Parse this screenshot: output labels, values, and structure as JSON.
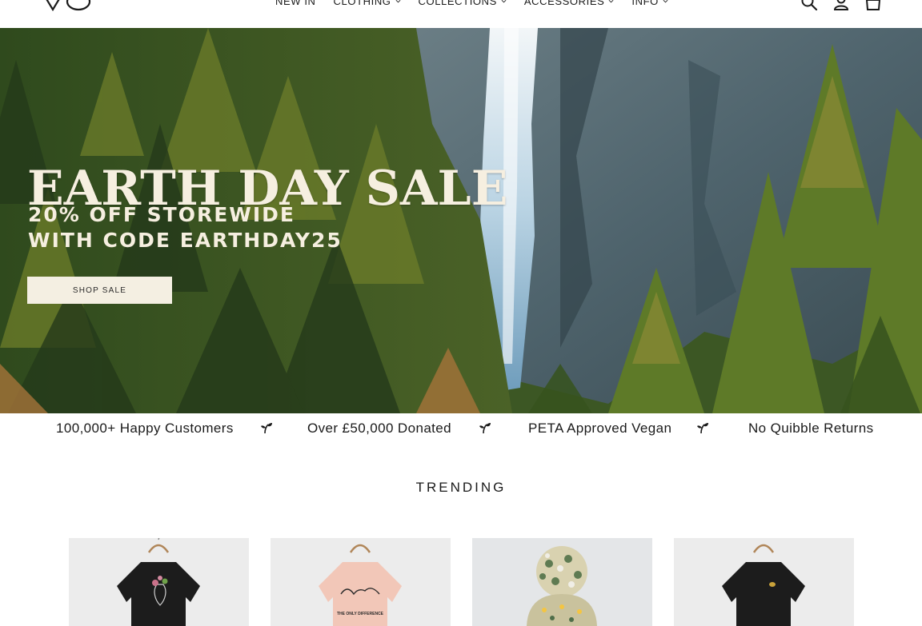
{
  "header": {
    "nav": [
      {
        "label": "NEW IN",
        "has_dropdown": true
      },
      {
        "label": "CLOTHING",
        "has_dropdown": true
      },
      {
        "label": "COLLECTIONS",
        "has_dropdown": true
      },
      {
        "label": "ACCESSORIES",
        "has_dropdown": true
      },
      {
        "label": "INFO",
        "has_dropdown": true
      }
    ],
    "icons": [
      "search-icon",
      "account-icon",
      "cart-icon"
    ]
  },
  "hero": {
    "title": "EARTH DAY SALE",
    "subtitle_line1": "20% OFF STOREWIDE",
    "subtitle_line2": "WITH CODE EARTHDAY25",
    "cta_label": "SHOP SALE",
    "text_color": "#f6efe0",
    "button_color": "#f4efe2"
  },
  "usp": {
    "items": [
      "100,000+ Happy Customers",
      "Over £50,000 Donated",
      "PETA Approved Vegan",
      "No Quibble Returns"
    ],
    "separator_icon": "sprout-icon"
  },
  "trending": {
    "title": "TRENDING",
    "products": [
      {
        "name": "black-floral-tshirt",
        "shirt_color": "#1c1c1c"
      },
      {
        "name": "pink-dog-tshirt",
        "shirt_color": "#f2c7b8",
        "print_text": "THE ONLY DIFFERENCE"
      },
      {
        "name": "knit-bobble-hat",
        "shirt_color": "#d9d2b0"
      },
      {
        "name": "black-embroidered-tshirt",
        "shirt_color": "#1c1c1c"
      }
    ]
  }
}
